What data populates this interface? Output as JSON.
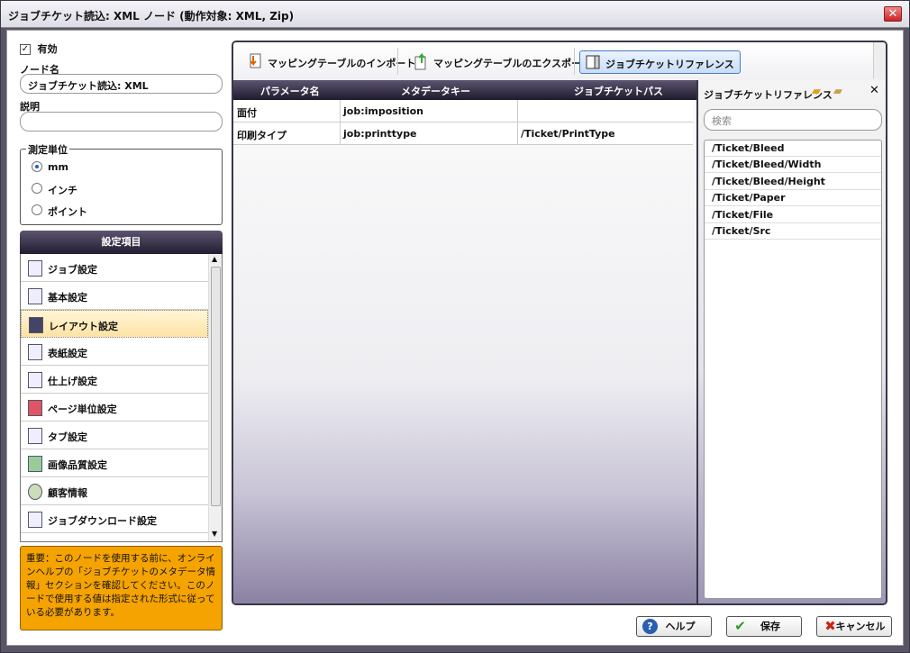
{
  "window": {
    "title": "ジョブチケット読込: XML ノード (動作対象: XML, Zip)",
    "close": "✕"
  },
  "left": {
    "enabled_label": "有効",
    "node_name_label": "ノード名",
    "node_name_value": "ジョブチケット読込: XML",
    "desc_label": "説明",
    "desc_value": "",
    "unit_group": "測定単位",
    "units": [
      "mm",
      "インチ",
      "ポイント"
    ],
    "selected_unit": "mm",
    "categories_header": "設定項目",
    "categories": [
      "ジョブ設定",
      "基本設定",
      "レイアウト設定",
      "表紙設定",
      "仕上げ設定",
      "ページ単位設定",
      "タブ設定",
      "画像品質設定",
      "顧客情報",
      "ジョブダウンロード設定"
    ],
    "selected_category": "レイアウト設定",
    "note": "重要：このノードを使用する前に、オンラインヘルプの「ジョブチケットのメタデータ情報」セクションを確認してください。このノードで使用する値は指定された形式に従っている必要があります。"
  },
  "toolbar": {
    "import": "マッピングテーブルのインポート",
    "export": "マッピングテーブルのエクスポート",
    "reference": "ジョブチケットリファレンス"
  },
  "grid": {
    "columns": [
      "パラメータ名",
      "メタデータキー",
      "ジョブチケットパス"
    ],
    "rows": [
      [
        "面付",
        "job:imposition",
        ""
      ],
      [
        "印刷タイプ",
        "job:printtype",
        "/Ticket/PrintType"
      ]
    ]
  },
  "reference": {
    "title": "ジョブチケットリファレンス",
    "search_placeholder": "検索",
    "items": [
      "/Ticket/Bleed",
      "/Ticket/Bleed/Width",
      "/Ticket/Bleed/Height",
      "/Ticket/Paper",
      "/Ticket/File",
      "/Ticket/Src"
    ]
  },
  "buttons": {
    "help": "ヘルプ",
    "save": "保存",
    "cancel": "キャンセル"
  },
  "colors": {
    "accent": "#1f5fbf",
    "note_bg": "#f5a300",
    "header_dark": "#221d30"
  }
}
